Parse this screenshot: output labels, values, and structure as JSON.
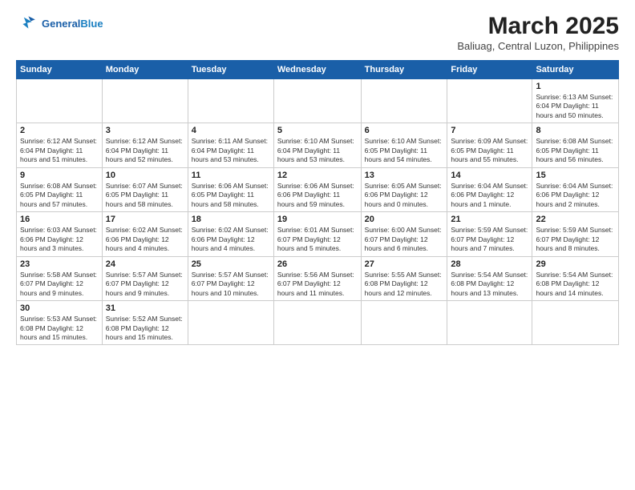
{
  "header": {
    "logo_line1": "General",
    "logo_line2": "Blue",
    "month_title": "March 2025",
    "location": "Baliuag, Central Luzon, Philippines"
  },
  "weekdays": [
    "Sunday",
    "Monday",
    "Tuesday",
    "Wednesday",
    "Thursday",
    "Friday",
    "Saturday"
  ],
  "weeks": [
    [
      {
        "day": "",
        "info": ""
      },
      {
        "day": "",
        "info": ""
      },
      {
        "day": "",
        "info": ""
      },
      {
        "day": "",
        "info": ""
      },
      {
        "day": "",
        "info": ""
      },
      {
        "day": "",
        "info": ""
      },
      {
        "day": "1",
        "info": "Sunrise: 6:13 AM\nSunset: 6:04 PM\nDaylight: 11 hours\nand 50 minutes."
      }
    ],
    [
      {
        "day": "2",
        "info": "Sunrise: 6:12 AM\nSunset: 6:04 PM\nDaylight: 11 hours\nand 51 minutes."
      },
      {
        "day": "3",
        "info": "Sunrise: 6:12 AM\nSunset: 6:04 PM\nDaylight: 11 hours\nand 52 minutes."
      },
      {
        "day": "4",
        "info": "Sunrise: 6:11 AM\nSunset: 6:04 PM\nDaylight: 11 hours\nand 53 minutes."
      },
      {
        "day": "5",
        "info": "Sunrise: 6:10 AM\nSunset: 6:04 PM\nDaylight: 11 hours\nand 53 minutes."
      },
      {
        "day": "6",
        "info": "Sunrise: 6:10 AM\nSunset: 6:05 PM\nDaylight: 11 hours\nand 54 minutes."
      },
      {
        "day": "7",
        "info": "Sunrise: 6:09 AM\nSunset: 6:05 PM\nDaylight: 11 hours\nand 55 minutes."
      },
      {
        "day": "8",
        "info": "Sunrise: 6:08 AM\nSunset: 6:05 PM\nDaylight: 11 hours\nand 56 minutes."
      }
    ],
    [
      {
        "day": "9",
        "info": "Sunrise: 6:08 AM\nSunset: 6:05 PM\nDaylight: 11 hours\nand 57 minutes."
      },
      {
        "day": "10",
        "info": "Sunrise: 6:07 AM\nSunset: 6:05 PM\nDaylight: 11 hours\nand 58 minutes."
      },
      {
        "day": "11",
        "info": "Sunrise: 6:06 AM\nSunset: 6:05 PM\nDaylight: 11 hours\nand 58 minutes."
      },
      {
        "day": "12",
        "info": "Sunrise: 6:06 AM\nSunset: 6:06 PM\nDaylight: 11 hours\nand 59 minutes."
      },
      {
        "day": "13",
        "info": "Sunrise: 6:05 AM\nSunset: 6:06 PM\nDaylight: 12 hours\nand 0 minutes."
      },
      {
        "day": "14",
        "info": "Sunrise: 6:04 AM\nSunset: 6:06 PM\nDaylight: 12 hours\nand 1 minute."
      },
      {
        "day": "15",
        "info": "Sunrise: 6:04 AM\nSunset: 6:06 PM\nDaylight: 12 hours\nand 2 minutes."
      }
    ],
    [
      {
        "day": "16",
        "info": "Sunrise: 6:03 AM\nSunset: 6:06 PM\nDaylight: 12 hours\nand 3 minutes."
      },
      {
        "day": "17",
        "info": "Sunrise: 6:02 AM\nSunset: 6:06 PM\nDaylight: 12 hours\nand 4 minutes."
      },
      {
        "day": "18",
        "info": "Sunrise: 6:02 AM\nSunset: 6:06 PM\nDaylight: 12 hours\nand 4 minutes."
      },
      {
        "day": "19",
        "info": "Sunrise: 6:01 AM\nSunset: 6:07 PM\nDaylight: 12 hours\nand 5 minutes."
      },
      {
        "day": "20",
        "info": "Sunrise: 6:00 AM\nSunset: 6:07 PM\nDaylight: 12 hours\nand 6 minutes."
      },
      {
        "day": "21",
        "info": "Sunrise: 5:59 AM\nSunset: 6:07 PM\nDaylight: 12 hours\nand 7 minutes."
      },
      {
        "day": "22",
        "info": "Sunrise: 5:59 AM\nSunset: 6:07 PM\nDaylight: 12 hours\nand 8 minutes."
      }
    ],
    [
      {
        "day": "23",
        "info": "Sunrise: 5:58 AM\nSunset: 6:07 PM\nDaylight: 12 hours\nand 9 minutes."
      },
      {
        "day": "24",
        "info": "Sunrise: 5:57 AM\nSunset: 6:07 PM\nDaylight: 12 hours\nand 9 minutes."
      },
      {
        "day": "25",
        "info": "Sunrise: 5:57 AM\nSunset: 6:07 PM\nDaylight: 12 hours\nand 10 minutes."
      },
      {
        "day": "26",
        "info": "Sunrise: 5:56 AM\nSunset: 6:07 PM\nDaylight: 12 hours\nand 11 minutes."
      },
      {
        "day": "27",
        "info": "Sunrise: 5:55 AM\nSunset: 6:08 PM\nDaylight: 12 hours\nand 12 minutes."
      },
      {
        "day": "28",
        "info": "Sunrise: 5:54 AM\nSunset: 6:08 PM\nDaylight: 12 hours\nand 13 minutes."
      },
      {
        "day": "29",
        "info": "Sunrise: 5:54 AM\nSunset: 6:08 PM\nDaylight: 12 hours\nand 14 minutes."
      }
    ],
    [
      {
        "day": "30",
        "info": "Sunrise: 5:53 AM\nSunset: 6:08 PM\nDaylight: 12 hours\nand 15 minutes."
      },
      {
        "day": "31",
        "info": "Sunrise: 5:52 AM\nSunset: 6:08 PM\nDaylight: 12 hours\nand 15 minutes."
      },
      {
        "day": "",
        "info": ""
      },
      {
        "day": "",
        "info": ""
      },
      {
        "day": "",
        "info": ""
      },
      {
        "day": "",
        "info": ""
      },
      {
        "day": "",
        "info": ""
      }
    ]
  ]
}
